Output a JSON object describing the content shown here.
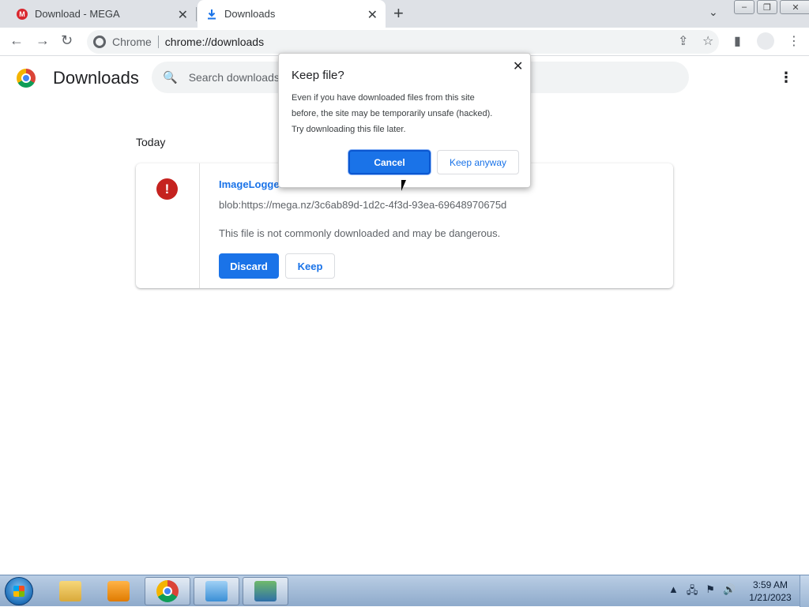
{
  "tabs": [
    {
      "title": "Download - MEGA",
      "favicon": "mega-icon",
      "active": false
    },
    {
      "title": "Downloads",
      "favicon": "download-icon",
      "active": true
    }
  ],
  "toolbar": {
    "site_label": "Chrome",
    "url": "chrome://downloads"
  },
  "downloads_page": {
    "title": "Downloads",
    "search_placeholder": "Search downloads",
    "section": "Today",
    "item": {
      "file_name": "ImageLogger",
      "source_url": "blob:https://mega.nz/3c6ab89d-1d2c-4f3d-93ea-69648970675d",
      "warning": "This file is not commonly downloaded and may be dangerous.",
      "discard_label": "Discard",
      "keep_label": "Keep"
    }
  },
  "dialog": {
    "title": "Keep file?",
    "body_lines": [
      "Even if you have downloaded files from this site",
      "before, the site may be temporarily unsafe (hacked).",
      "Try downloading this file later."
    ],
    "cancel_label": "Cancel",
    "keep_anyway_label": "Keep anyway"
  },
  "taskbar": {
    "time": "3:59 AM",
    "date": "1/21/2023"
  },
  "colors": {
    "accent": "#1a73e8",
    "danger": "#c5221f",
    "mega_red": "#d9272e"
  }
}
